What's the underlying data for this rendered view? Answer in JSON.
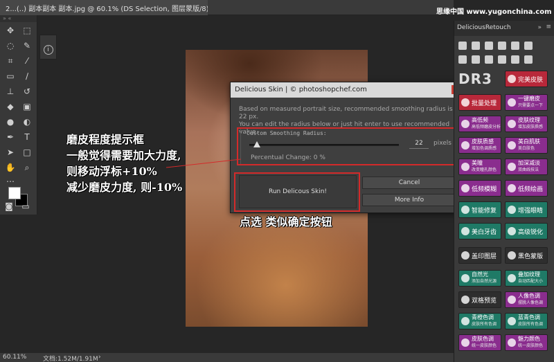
{
  "document_tab": {
    "title": "2...(..) 副本副本 副本.jpg @ 60.1% (DS Selection, 图层蒙版/8) *",
    "close": "×"
  },
  "watermark": "思缘中国 www.yugonchina.com",
  "toolbar": {
    "grip": "» «"
  },
  "side_mini": {
    "info_icon": "i"
  },
  "status": {
    "zoom": "60.11%",
    "doc_info": "文档:1.52M/1.91M",
    "arrow": "›"
  },
  "dialog": {
    "title": "Delicious Skin | © photoshopchef.com",
    "close": "x",
    "description_line1": "Based on measured portrait size, recommended smoothing radius is 22 px.",
    "description_line2": "You can edit the radius below or just hit enter to use recommended value.",
    "group_label": "Custom Smoothing Radius:",
    "radius_value": "22",
    "radius_fraction": 0.05,
    "unit": "pixels",
    "percentual_change": "Percentual Change: 0 %",
    "run_button": "Run Delicous Skin!",
    "cancel_button": "Cancel",
    "more_button": "More Info"
  },
  "annotations": {
    "left_title": "磨皮程度提示框",
    "left_line2": "一般觉得需要加大力度,",
    "left_line3": "则移动浮标+10%",
    "left_line4": "减少磨皮力度, 则-10%",
    "bottom": "点选 类似确定按钮"
  },
  "retouch_panel": {
    "title": "DeliciousRetouch",
    "collapse": "»",
    "menu": "≡",
    "logo": "DR3",
    "buttons": [
      {
        "label": "完美皮肤",
        "sub": "",
        "color": "#b8283a"
      },
      {
        "label": "批量处理",
        "sub": "",
        "color": "#b8283a"
      },
      {
        "label": "一键磨皮",
        "sub": "只需要点一下",
        "color": "#8a2d8e"
      },
      {
        "label": "高低频",
        "sub": "高低频磨皮分析",
        "color": "#8a2d8e"
      },
      {
        "label": "皮肤纹理",
        "sub": "增加皮肤质感",
        "color": "#8a2d8e"
      },
      {
        "label": "皮肤质感",
        "sub": "增加色调质感",
        "color": "#8a2d8e"
      },
      {
        "label": "美白肌肤",
        "sub": "美白肤色",
        "color": "#8a2d8e"
      },
      {
        "label": "美瞳",
        "sub": "改变瞳孔颜色",
        "color": "#8a2d8e"
      },
      {
        "label": "加深减淡",
        "sub": "双曲线技法",
        "color": "#8a2d8e"
      },
      {
        "label": "低频模糊",
        "sub": "",
        "color": "#8a2d8e"
      },
      {
        "label": "低频绘画",
        "sub": "",
        "color": "#8a2d8e"
      },
      {
        "label": "智能修复",
        "sub": "",
        "color": "#1f7a66"
      },
      {
        "label": "增强眼睛",
        "sub": "",
        "color": "#1f7a66"
      },
      {
        "label": "美白牙齿",
        "sub": "",
        "color": "#1f7a66"
      },
      {
        "label": "高级锐化",
        "sub": "",
        "color": "#1f7a66"
      },
      {
        "label": "盖印图层",
        "sub": "",
        "color": "#2e2e2e"
      },
      {
        "label": "黑色蒙版",
        "sub": "",
        "color": "#2e2e2e"
      },
      {
        "label": "自然光",
        "sub": "添加自然光源",
        "color": "#1f7a66"
      },
      {
        "label": "叠加纹理",
        "sub": "自动匹配大小",
        "color": "#1f7a66"
      },
      {
        "label": "双格预览",
        "sub": "",
        "color": "#2e2e2e"
      },
      {
        "label": "人像色调",
        "sub": "摆脱人像色调",
        "color": "#8a2d8e"
      },
      {
        "label": "青橙色调",
        "sub": "皮肤所有色调",
        "color": "#1f7a66"
      },
      {
        "label": "蓝青色调",
        "sub": "皮肤所有色调",
        "color": "#1f7a66"
      },
      {
        "label": "皮肤色调",
        "sub": "统一皮肤颜色",
        "color": "#8a2d8e"
      },
      {
        "label": "魅力颜色",
        "sub": "统一皮肤颜色",
        "color": "#8a2d8e"
      }
    ]
  }
}
